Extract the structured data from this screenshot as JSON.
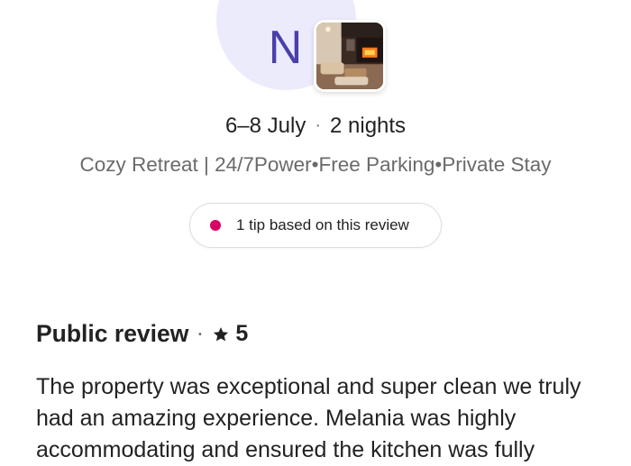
{
  "guest": {
    "initial": "N"
  },
  "stay": {
    "dates": "6–8 July",
    "separator": "·",
    "nights": "2 nights"
  },
  "listing": {
    "title": "Cozy Retreat | 24/7Power•Free Parking•Private Stay"
  },
  "tip": {
    "label": "1 tip based on this review",
    "dot_color": "#d70466"
  },
  "review": {
    "heading": "Public review",
    "separator": "·",
    "rating": "5",
    "text": "The property was exceptional and super clean we truly had an amazing experience. Melania was highly accommodating and ensured the kitchen was fully"
  },
  "colors": {
    "avatar_bg": "#ecebfc",
    "avatar_letter": "#4b3fa9",
    "text_primary": "#222222",
    "text_secondary": "#6a6a6a"
  }
}
